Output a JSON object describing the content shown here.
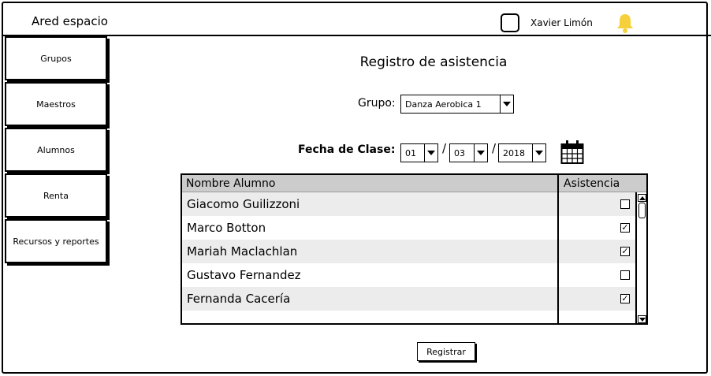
{
  "header": {
    "app_title": "Ared espacio",
    "user_name": "Xavier Limón",
    "bell_color": "#f5d03b"
  },
  "sidebar": {
    "items": [
      {
        "label": "Grupos"
      },
      {
        "label": "Maestros"
      },
      {
        "label": "Alumnos"
      },
      {
        "label": "Renta"
      },
      {
        "label": "Recursos y reportes"
      }
    ]
  },
  "main": {
    "title": "Registro de asistencia",
    "group_label": "Grupo:",
    "group_value": "Danza Aerobica 1",
    "date_label": "Fecha de Clase:",
    "date_day": "01",
    "date_month": "03",
    "date_year": "2018",
    "date_separator": "/",
    "table": {
      "headers": [
        "Nombre Alumno",
        "Asistencia"
      ],
      "rows": [
        {
          "name": "Giacomo Guilizzoni",
          "checked": false
        },
        {
          "name": "Marco Botton",
          "checked": true
        },
        {
          "name": "Mariah Maclachlan",
          "checked": true
        },
        {
          "name": "Gustavo Fernandez",
          "checked": false
        },
        {
          "name": "Fernanda Cacería",
          "checked": true
        }
      ]
    },
    "submit_label": "Registrar"
  }
}
